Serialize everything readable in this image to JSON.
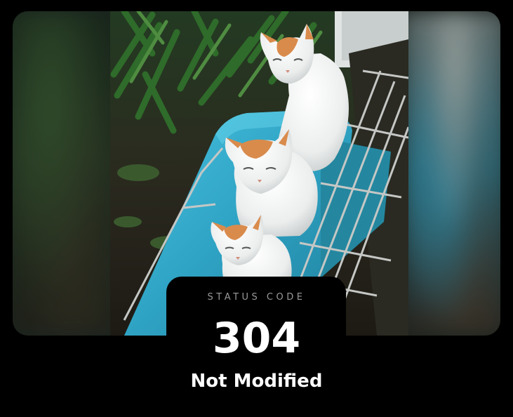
{
  "status": {
    "label": "STATUS CODE",
    "code": "304",
    "message": "Not Modified"
  },
  "colors": {
    "background": "#000000",
    "label": "#9a9a9a",
    "code": "#ffffff",
    "message": "#ffffff",
    "cushion": "#2fa3c4"
  },
  "image": {
    "subject": "three white cats with orange patches sitting on a turquoise cushion beside a wire rack"
  }
}
